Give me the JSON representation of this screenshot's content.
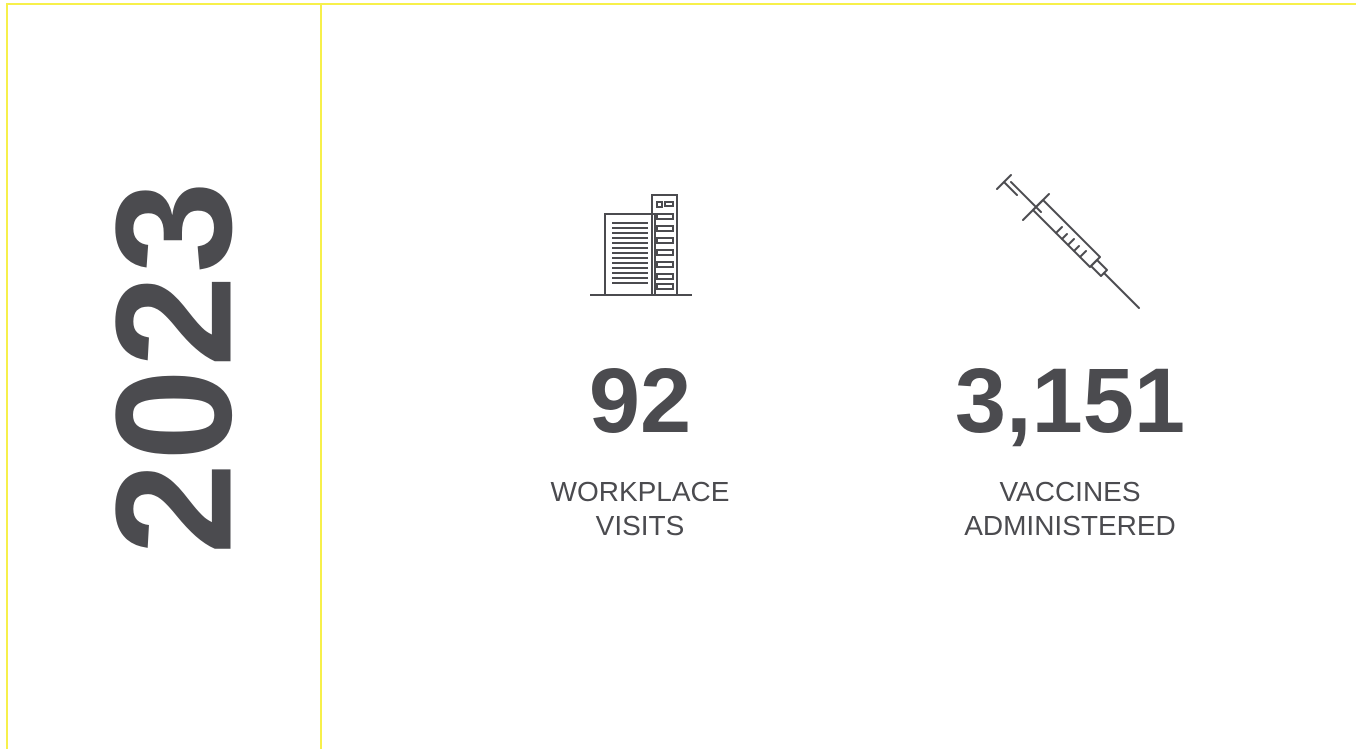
{
  "year": "2023",
  "stats": [
    {
      "icon": "office-building-icon",
      "value": "92",
      "label_line1": "WORKPLACE",
      "label_line2": "VISITS"
    },
    {
      "icon": "syringe-icon",
      "value": "3,151",
      "label_line1": "VACCINES",
      "label_line2": "ADMINISTERED"
    }
  ],
  "colors": {
    "text": "#4b4b4f",
    "accent_line": "#f7f04b",
    "background": "#ffffff"
  }
}
